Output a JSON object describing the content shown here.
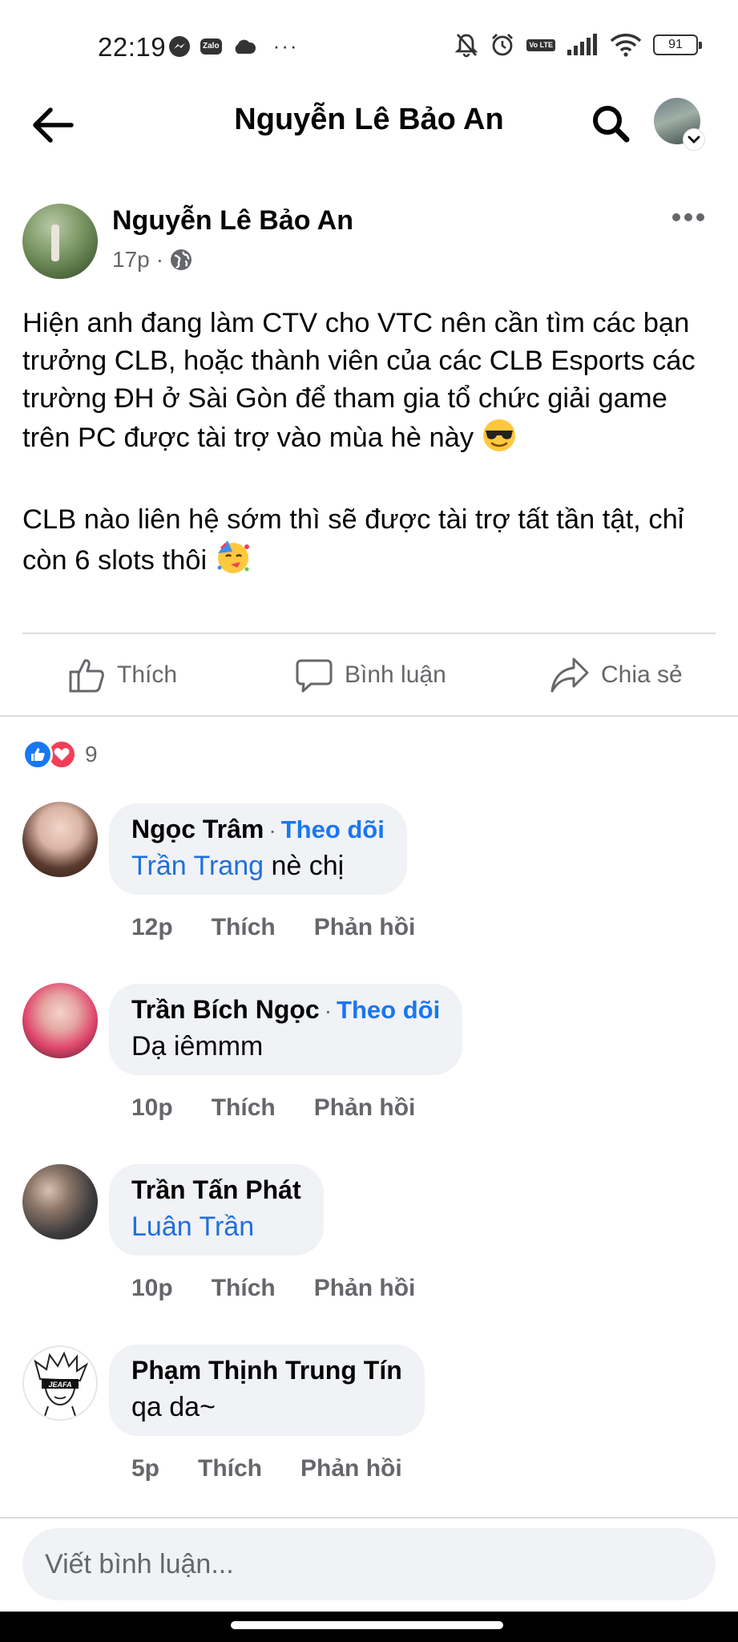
{
  "status_bar": {
    "time": "22:19",
    "battery": "91",
    "zalo_label": "Zalo",
    "volte_label": "Vo LTE",
    "more_dots": "···"
  },
  "header": {
    "title": "Nguyễn Lê Bảo An"
  },
  "post": {
    "author": "Nguyễn Lê Bảo An",
    "time": "17p",
    "meta_sep": "·",
    "paragraph_1": "Hiện anh đang làm CTV cho VTC nên cần tìm các bạn trưởng CLB, hoặc thành viên của các CLB Esports các trường ĐH ở Sài Gòn để tham gia tổ chức giải game trên PC được tài trợ vào mùa hè này",
    "paragraph_2": "CLB nào liên hệ sớm thì sẽ được tài trợ tất tần tật, chỉ còn 6 slots thôi"
  },
  "actions": {
    "like": "Thích",
    "comment": "Bình luận",
    "share": "Chia sẻ"
  },
  "reactions": {
    "count": "9"
  },
  "comments": [
    {
      "name": "Ngọc Trâm",
      "sep": "·",
      "follow": "Theo dõi",
      "mention": "Trần Trang",
      "text": " nè chị",
      "time": "12p",
      "like": "Thích",
      "reply": "Phản hồi"
    },
    {
      "name": "Trần Bích Ngọc",
      "sep": "·",
      "follow": "Theo dõi",
      "text": "Dạ iêmmm",
      "time": "10p",
      "like": "Thích",
      "reply": "Phản hồi"
    },
    {
      "name": "Trần Tấn Phát",
      "mention": "Luân Trần",
      "time": "10p",
      "like": "Thích",
      "reply": "Phản hồi"
    },
    {
      "name": "Phạm Thịnh Trung Tín",
      "text": "qa da~",
      "time": "5p",
      "like": "Thích",
      "reply": "Phản hồi",
      "avatar_text": "JEAFA"
    }
  ],
  "composer": {
    "placeholder": "Viết bình luận..."
  },
  "colors": {
    "accent_blue": "#1877f2",
    "secondary_text": "#65676b",
    "bubble_bg": "#f0f2f5",
    "love_red": "#f33e58"
  }
}
